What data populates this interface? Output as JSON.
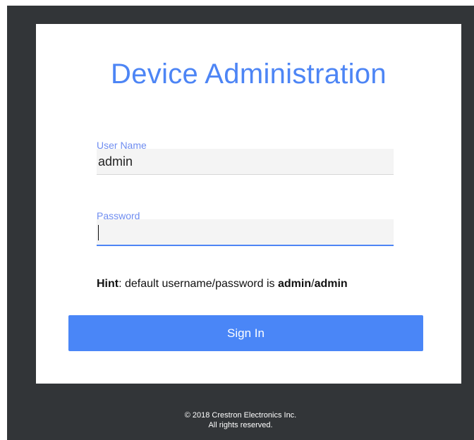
{
  "login": {
    "title": "Device Administration",
    "username_label": "User Name",
    "username_value": "admin",
    "password_label": "Password",
    "password_value": "",
    "hint_label": "Hint",
    "hint_text": ": default username/password is ",
    "hint_user": "admin",
    "hint_sep": "/",
    "hint_pass": "admin",
    "signin_label": "Sign In"
  },
  "footer": {
    "line1": "© 2018 Crestron Electronics Inc.",
    "line2": "All rights reserved."
  },
  "colors": {
    "accent": "#4a86f7",
    "title": "#4d85f5",
    "background": "#323538"
  }
}
